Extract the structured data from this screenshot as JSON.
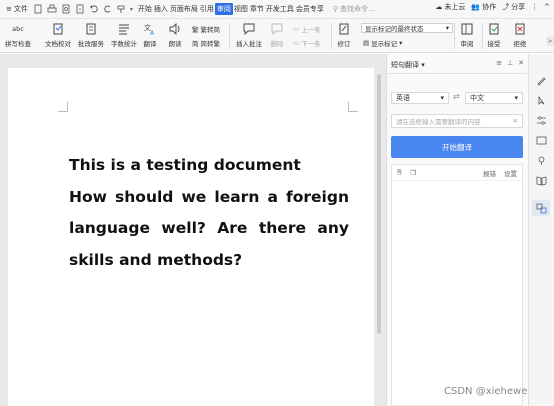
{
  "menubar": {
    "file_label": "文件",
    "tabs": [
      "开始",
      "插入",
      "页面布局",
      "引用",
      "审阅",
      "视图",
      "章节",
      "开发工具",
      "会员专享"
    ],
    "active_tab": "审阅",
    "search_placeholder": "查找命令...",
    "cloud_label": "未上云",
    "collab_label": "协作",
    "share_label": "分享"
  },
  "ribbon": {
    "abc": "abc",
    "spellcheck": "拼写检查",
    "compare": "文档校对",
    "batch": "批改服务",
    "wordcount": "字数统计",
    "translate": "翻译",
    "read": "朗读",
    "trad": "繁转简",
    "simp": "简转繁",
    "insert_comment": "插入批注",
    "delete": "删除",
    "prev": "上一条",
    "next": "下一条",
    "revise": "修订",
    "display_combo": "显示标记的最终状态",
    "show_markup": "显示标记",
    "review": "审阅",
    "accept": "接受",
    "reject": "拒绝"
  },
  "document": {
    "paragraphs": [
      "This is a testing document",
      "How should we learn a foreign language well? Are there any skills and methods?"
    ]
  },
  "pane": {
    "title": "短句翻译",
    "source_lang": "英语",
    "target_lang": "中文",
    "input_placeholder": "请在选框输入需要翻译的内容",
    "start_button": "开始翻译",
    "feedback": "报错",
    "settings": "设置"
  },
  "watermark": "CSDN @xiehewe",
  "colors": {
    "accent": "#2f6fe4",
    "button": "#4a86f0"
  }
}
